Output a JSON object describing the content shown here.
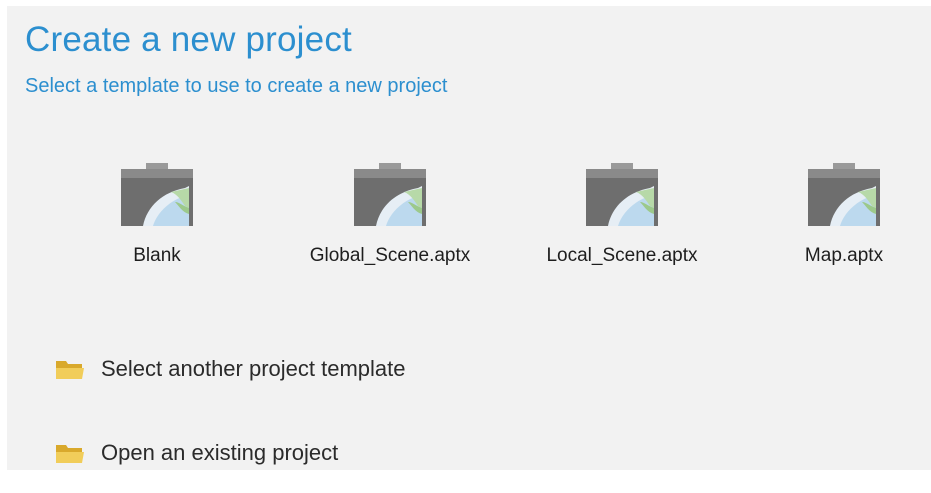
{
  "header": {
    "title": "Create a new project",
    "subtitle": "Select a template to use to create a new project"
  },
  "templates": [
    {
      "label": "Blank",
      "icon": "project-template-icon"
    },
    {
      "label": "Global_Scene.aptx",
      "icon": "project-template-icon"
    },
    {
      "label": "Local_Scene.aptx",
      "icon": "project-template-icon"
    },
    {
      "label": "Map.aptx",
      "icon": "project-template-icon"
    }
  ],
  "actions": [
    {
      "label": "Select another project template",
      "icon": "folder-icon"
    },
    {
      "label": "Open an existing project",
      "icon": "folder-icon"
    }
  ],
  "colors": {
    "accent": "#2c8fcf",
    "panel_bg": "#f2f2f2",
    "folder": "#e8c24a"
  }
}
